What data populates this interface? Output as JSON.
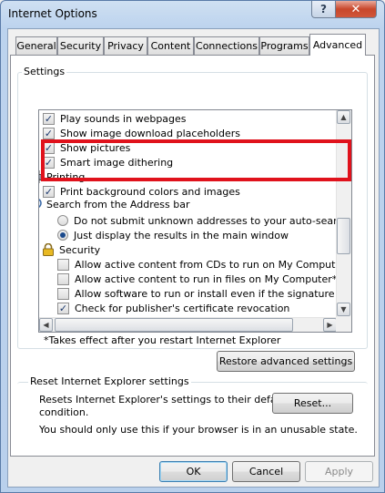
{
  "window": {
    "title": "Internet Options",
    "help_label": "?",
    "close_label": "✕"
  },
  "tabs": [
    {
      "label": "General"
    },
    {
      "label": "Security"
    },
    {
      "label": "Privacy"
    },
    {
      "label": "Content"
    },
    {
      "label": "Connections"
    },
    {
      "label": "Programs"
    },
    {
      "label": "Advanced",
      "active": true
    }
  ],
  "settings": {
    "group_label": "Settings",
    "items": [
      {
        "type": "checkbox",
        "checked": true,
        "label": "Play sounds in webpages"
      },
      {
        "type": "checkbox",
        "checked": true,
        "label": "Show image download placeholders"
      },
      {
        "type": "checkbox",
        "checked": true,
        "label": "Show pictures"
      },
      {
        "type": "checkbox",
        "checked": true,
        "label": "Smart image dithering"
      },
      {
        "type": "category",
        "icon": "printer-icon",
        "label": "Printing"
      },
      {
        "type": "checkbox",
        "checked": true,
        "label": "Print background colors and images"
      },
      {
        "type": "category",
        "icon": "search-icon",
        "label": "Search from the Address bar"
      },
      {
        "type": "radio",
        "selected": false,
        "label": "Do not submit unknown addresses to your auto-search pro"
      },
      {
        "type": "radio",
        "selected": true,
        "label": "Just display the results in the main window"
      },
      {
        "type": "category",
        "icon": "lock-icon",
        "label": "Security"
      },
      {
        "type": "checkbox",
        "checked": false,
        "label": "Allow active content from CDs to run on My Computer*"
      },
      {
        "type": "checkbox",
        "checked": false,
        "label": "Allow active content to run in files on My Computer*"
      },
      {
        "type": "checkbox",
        "checked": false,
        "label": "Allow software to run or install even if the signature is inva"
      },
      {
        "type": "checkbox",
        "checked": true,
        "label": "Check for publisher's certificate revocation"
      }
    ],
    "note": "*Takes effect after you restart Internet Explorer",
    "restore_button": "Restore advanced settings"
  },
  "reset": {
    "group_label": "Reset Internet Explorer settings",
    "description_line1": "Resets Internet Explorer's settings to their default",
    "description_line2": "condition.",
    "reset_button": "Reset...",
    "warning": "You should only use this if your browser is in an unusable state."
  },
  "footer": {
    "ok": "OK",
    "cancel": "Cancel",
    "apply": "Apply"
  },
  "scroll": {
    "up": "▲",
    "down": "▼",
    "left": "◀",
    "right": "▶"
  },
  "colors": {
    "highlight": "#e0121c",
    "titlebar": "#bcd3ee",
    "close_button": "#c8472b"
  }
}
